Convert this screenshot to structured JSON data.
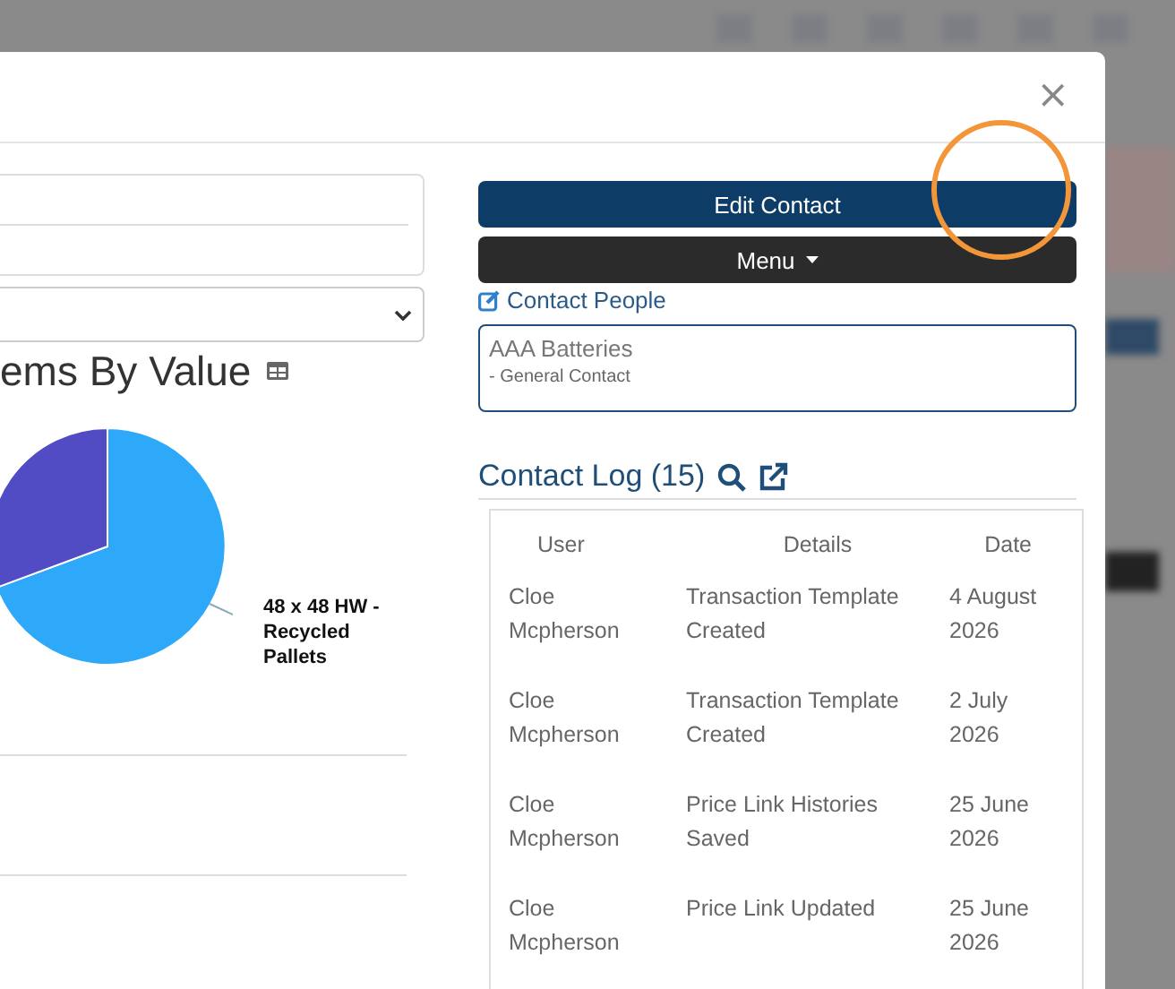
{
  "dialog": {
    "close": "×"
  },
  "left_panel": {
    "chart": {
      "title": "ems By Value",
      "slice_labels": [
        "48 x 48 HW - Recycled Pallets"
      ]
    }
  },
  "right_panel": {
    "edit_button": "Edit Contact",
    "menu_button": "Menu",
    "contact_people_link": "Contact People",
    "contact": {
      "name": "AAA Batteries",
      "role": "- General Contact"
    },
    "log": {
      "title": "Contact Log (15)",
      "columns": [
        "User",
        "Details",
        "Date"
      ],
      "rows": [
        {
          "user": "Cloe Mcpherson",
          "details": "Transaction Template Created",
          "date": "4 August 2026"
        },
        {
          "user": "Cloe Mcpherson",
          "details": "Transaction Template Created",
          "date": "2 July 2026"
        },
        {
          "user": "Cloe Mcpherson",
          "details": "Price Link Histories Saved",
          "date": "25 June 2026"
        },
        {
          "user": "Cloe Mcpherson",
          "details": "Price Link Updated",
          "date": "25 June 2026"
        }
      ]
    }
  }
}
